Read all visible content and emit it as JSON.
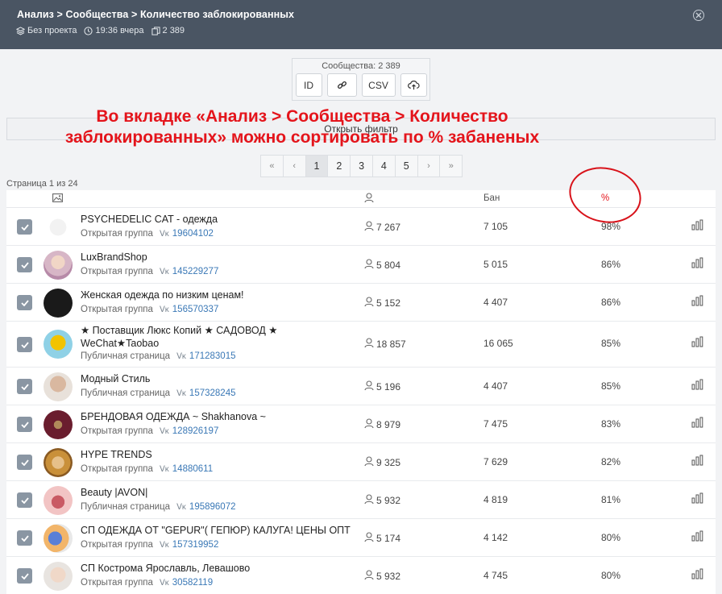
{
  "header": {
    "breadcrumb": "Анализ > Сообщества > Количество заблокированных",
    "project": "Без проекта",
    "time": "19:36 вчера",
    "count": "2 389"
  },
  "export": {
    "title": "Сообщества: 2 389",
    "buttons": [
      "ID",
      "link-icon",
      "CSV",
      "cloud-upload-icon"
    ],
    "id_label": "ID",
    "csv_label": "CSV"
  },
  "filter": {
    "label": "Открыть фильтр"
  },
  "annotation": {
    "line1": "Во вкладке «Анализ > Сообщества > Количество",
    "line2": "заблокированных» можно сортировать по % забаненых"
  },
  "pagination": {
    "first": "«",
    "prev": "‹",
    "next": "›",
    "last": "»",
    "pages": [
      "1",
      "2",
      "3",
      "4",
      "5"
    ],
    "current": "1"
  },
  "page_info": "Страница 1 из 24",
  "table": {
    "col_ban": "Бан",
    "col_pct": "%",
    "rows": [
      {
        "name": "PSYCHEDELIC CAT - одежда",
        "type": "Открытая группа",
        "id": "19604102",
        "members": "7 267",
        "ban": "7 105",
        "pct": "98%"
      },
      {
        "name": "LuxBrandShop",
        "type": "Открытая группа",
        "id": "145229277",
        "members": "5 804",
        "ban": "5 015",
        "pct": "86%"
      },
      {
        "name": "Женская одежда по низким ценам!",
        "type": "Открытая группа",
        "id": "156570337",
        "members": "5 152",
        "ban": "4 407",
        "pct": "86%"
      },
      {
        "name": "★ Поставщик Люкс Копий ★ САДОВОД ★ WeChat★Taobao",
        "type": "Публичная страница",
        "id": "171283015",
        "members": "18 857",
        "ban": "16 065",
        "pct": "85%"
      },
      {
        "name": "Модный Стиль",
        "type": "Публичная страница",
        "id": "157328245",
        "members": "5 196",
        "ban": "4 407",
        "pct": "85%"
      },
      {
        "name": "БРЕНДОВАЯ ОДЕЖДА ~ Shakhanova ~",
        "type": "Открытая группа",
        "id": "128926197",
        "members": "8 979",
        "ban": "7 475",
        "pct": "83%"
      },
      {
        "name": "HYPE TRENDS",
        "type": "Открытая группа",
        "id": "14880611",
        "members": "9 325",
        "ban": "7 629",
        "pct": "82%"
      },
      {
        "name": "Beauty |AVON|",
        "type": "Публичная страница",
        "id": "195896072",
        "members": "5 932",
        "ban": "4 819",
        "pct": "81%"
      },
      {
        "name": "СП ОДЕЖДА ОТ \"GEPUR\"( ГЕПЮР) КАЛУГА! ЦЕНЫ ОПТ",
        "type": "Открытая группа",
        "id": "157319952",
        "members": "5 174",
        "ban": "4 142",
        "pct": "80%"
      },
      {
        "name": "СП Кострома Ярославль, Левашово",
        "type": "Открытая группа",
        "id": "30582119",
        "members": "5 932",
        "ban": "4 745",
        "pct": "80%"
      }
    ]
  },
  "colors": {
    "header_bg": "#4a5563",
    "annotation": "#e4141b",
    "link": "#3a78b6",
    "checkbox": "#8a96a3"
  }
}
